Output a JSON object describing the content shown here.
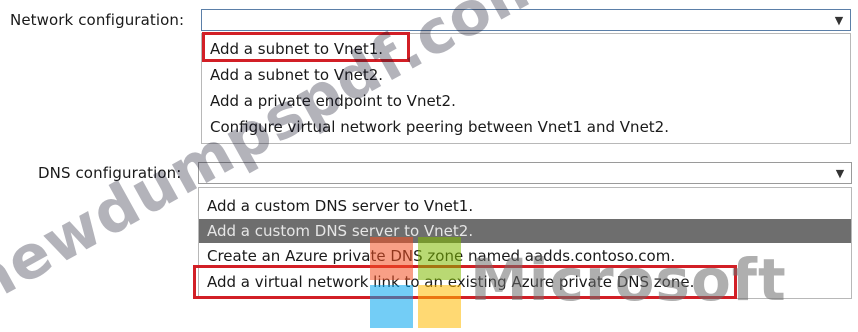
{
  "network": {
    "label": "Network configuration:",
    "selected_value": "",
    "options": [
      "Add a subnet to Vnet1.",
      "Add a subnet to Vnet2.",
      "Add a private endpoint to Vnet2.",
      "Configure virtual network peering between Vnet1 and Vnet2."
    ],
    "marked_option_index": 0
  },
  "dns": {
    "label": "DNS configuration:",
    "selected_value": "",
    "options": [
      "Add a custom DNS server to Vnet1.",
      "Add a custom DNS server to Vnet2.",
      "Create an Azure private DNS zone named aadds.contoso.com.",
      "Add a virtual network link to an existing Azure private DNS zone."
    ],
    "highlighted_option_index": 1,
    "marked_option_index": 3
  },
  "watermark": {
    "diagonal_text": "newdumpspdf.com",
    "brand_text": "Microsoft",
    "logo_colors": [
      "#f25022",
      "#7fba00",
      "#00a4ef",
      "#ffb900"
    ]
  },
  "colors": {
    "mark_red": "#d21f26",
    "highlight_gray": "#6e6e6e"
  },
  "icons": {
    "dropdown": "chevron-down-icon"
  }
}
